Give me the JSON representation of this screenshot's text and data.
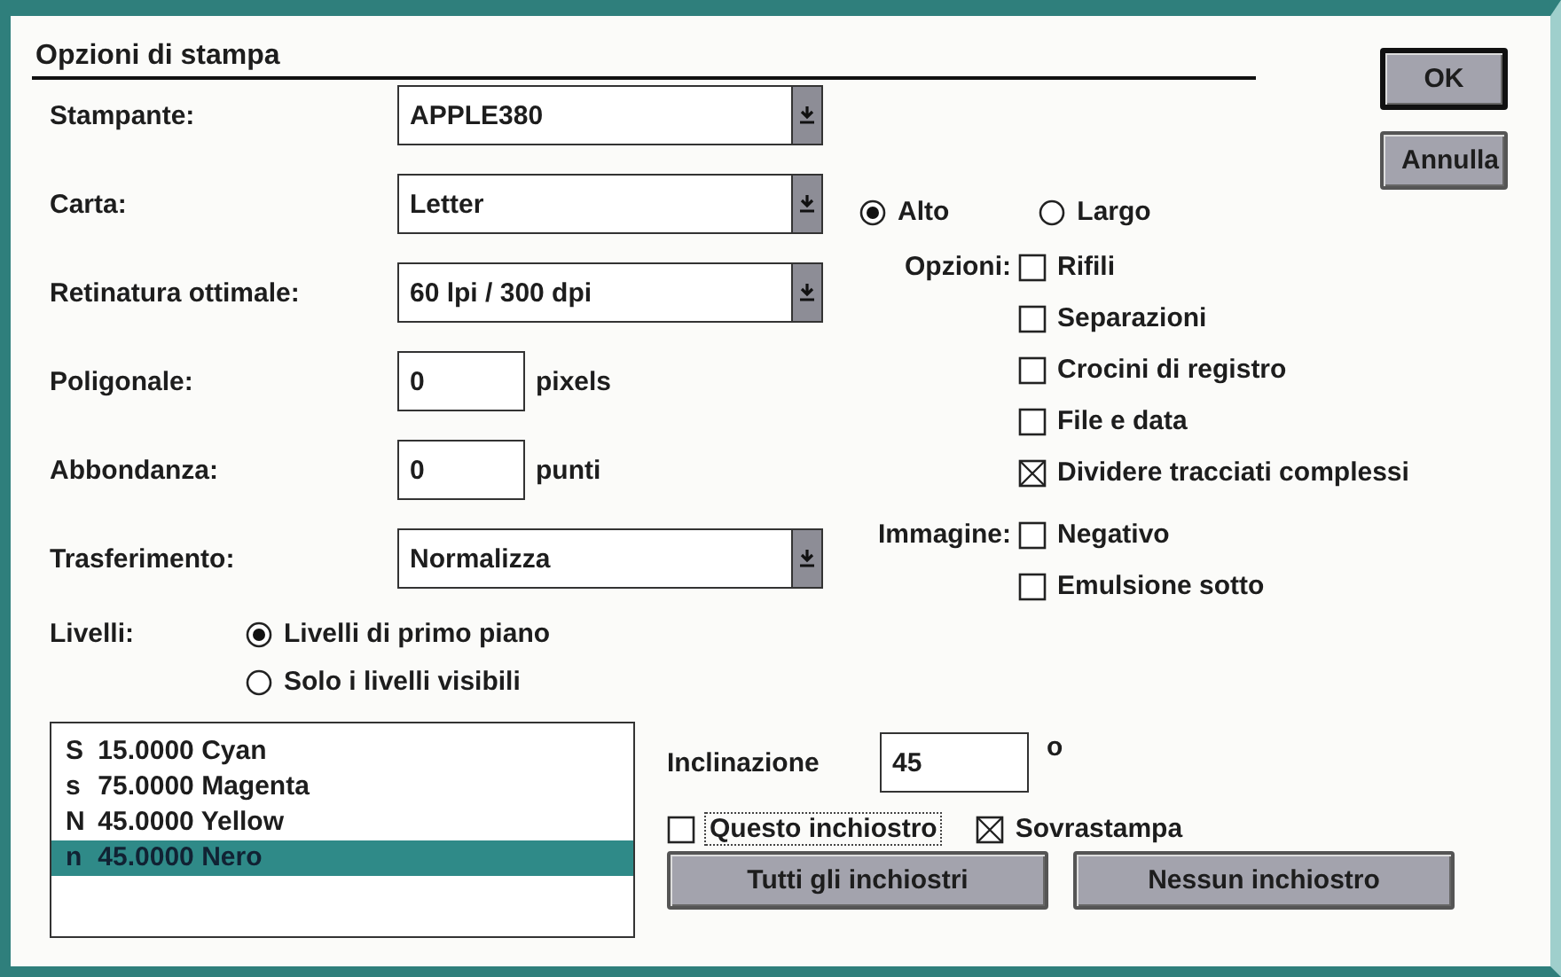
{
  "dialog": {
    "title": "Opzioni di stampa"
  },
  "buttons": [
    {
      "label": "OK",
      "default": true
    },
    {
      "label": "Annulla",
      "default": false
    }
  ],
  "fields": [
    {
      "kind": "combo",
      "label": "Stampante:",
      "value": "APPLE380"
    },
    {
      "kind": "combo",
      "label": "Carta:",
      "value": "Letter"
    },
    {
      "kind": "combo",
      "label": "Retinatura ottimale:",
      "value": "60 lpi / 300 dpi"
    },
    {
      "kind": "number",
      "label": "Poligonale:",
      "value": "0",
      "unit": "pixels"
    },
    {
      "kind": "number",
      "label": "Abbondanza:",
      "value": "0",
      "unit": "punti"
    },
    {
      "kind": "combo",
      "label": "Trasferimento:",
      "value": "Normalizza"
    }
  ],
  "orientation": [
    {
      "label": "Alto",
      "selected": true
    },
    {
      "label": "Largo",
      "selected": false
    }
  ],
  "options": {
    "label": "Opzioni:",
    "items": [
      {
        "label": "Rifili",
        "checked": false
      },
      {
        "label": "Separazioni",
        "checked": false
      },
      {
        "label": "Crocini di registro",
        "checked": false
      },
      {
        "label": "File e data",
        "checked": false
      },
      {
        "label": "Dividere tracciati complessi",
        "checked": true
      }
    ]
  },
  "image": {
    "label": "Immagine:",
    "items": [
      {
        "label": "Negativo",
        "checked": false
      },
      {
        "label": "Emulsione sotto",
        "checked": false
      }
    ]
  },
  "levels": {
    "label": "Livelli:",
    "items": [
      {
        "label": "Livelli di primo piano",
        "selected": true
      },
      {
        "label": "Solo i livelli visibili",
        "selected": false
      }
    ]
  },
  "inks": [
    {
      "code": "S",
      "angle": "15.0000",
      "name": "Cyan",
      "selected": false
    },
    {
      "code": "s",
      "angle": "75.0000",
      "name": "Magenta",
      "selected": false
    },
    {
      "code": "N",
      "angle": "45.0000",
      "name": "Yellow",
      "selected": false
    },
    {
      "code": "n",
      "angle": "45.0000",
      "name": "Nero",
      "selected": true
    }
  ],
  "angle": {
    "label": "Inclinazione",
    "value": "45",
    "unit": "o"
  },
  "this_ink": {
    "label": "Questo inchiostro",
    "checked": false
  },
  "overprint": {
    "label": "Sovrastampa",
    "checked": true
  },
  "ink_buttons": [
    "Tutti gli inchiostri",
    "Nessun inchiostro"
  ]
}
